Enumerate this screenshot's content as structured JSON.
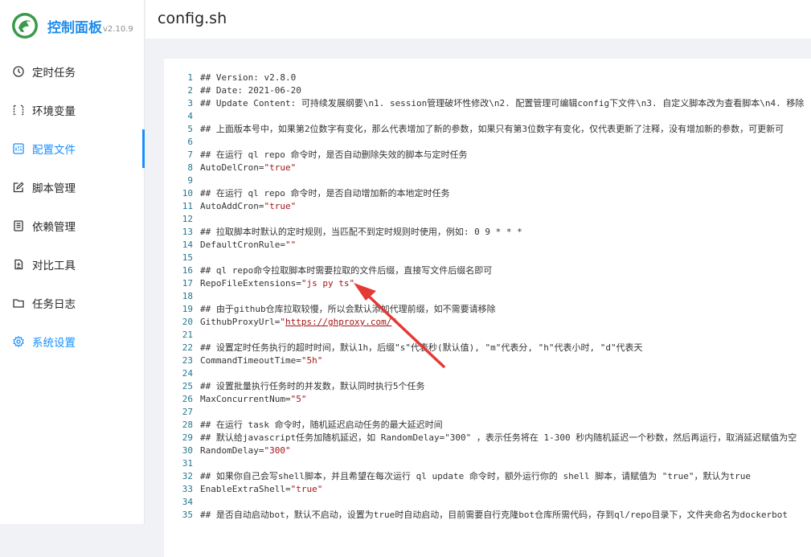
{
  "app": {
    "name": "控制面板",
    "version": "v2.10.9"
  },
  "sidebar": {
    "items": [
      {
        "label": "定时任务",
        "icon": "clock-icon"
      },
      {
        "label": "环境变量",
        "icon": "variable-icon"
      },
      {
        "label": "配置文件",
        "icon": "control-icon",
        "active": true
      },
      {
        "label": "脚本管理",
        "icon": "edit-icon"
      },
      {
        "label": "依赖管理",
        "icon": "container-icon"
      },
      {
        "label": "对比工具",
        "icon": "diff-icon"
      },
      {
        "label": "任务日志",
        "icon": "folder-icon"
      },
      {
        "label": "系统设置",
        "icon": "gear-icon"
      }
    ]
  },
  "header": {
    "title": "config.sh"
  },
  "colors": {
    "accent": "#1890ff",
    "brand": "#1f8ded",
    "string": "#a31515",
    "line_number": "#237893",
    "arrow": "#e53935"
  },
  "editor": {
    "lines": [
      {
        "n": "1",
        "text": "## Version: v2.8.0"
      },
      {
        "n": "2",
        "text": "## Date: 2021-06-20"
      },
      {
        "n": "3",
        "text": "## Update Content: 可持续发展纲要\\n1. session管理破坏性修改\\n2. 配置管理可编辑config下文件\\n3. 自定义脚本改为查看脚本\\n4. 移除"
      },
      {
        "n": "4",
        "text": ""
      },
      {
        "n": "5",
        "text": "## 上面版本号中，如果第2位数字有变化，那么代表增加了新的参数，如果只有第3位数字有变化，仅代表更新了注释，没有增加新的参数，可更新可"
      },
      {
        "n": "6",
        "text": ""
      },
      {
        "n": "7",
        "text": "## 在运行 ql repo 命令时，是否自动删除失效的脚本与定时任务"
      },
      {
        "n": "8",
        "key": "AutoDelCron=",
        "str": "\"true\""
      },
      {
        "n": "9",
        "text": ""
      },
      {
        "n": "10",
        "text": "## 在运行 ql repo 命令时，是否自动增加新的本地定时任务"
      },
      {
        "n": "11",
        "key": "AutoAddCron=",
        "str": "\"true\""
      },
      {
        "n": "12",
        "text": ""
      },
      {
        "n": "13",
        "text": "## 拉取脚本时默认的定时规则，当匹配不到定时规则时使用，例如: 0 9 * * *"
      },
      {
        "n": "14",
        "key": "DefaultCronRule=",
        "str": "\"\""
      },
      {
        "n": "15",
        "text": ""
      },
      {
        "n": "16",
        "text": "## ql repo命令拉取脚本时需要拉取的文件后缀，直接写文件后缀名即可"
      },
      {
        "n": "17",
        "key": "RepoFileExtensions=",
        "str": "\"js py ts\""
      },
      {
        "n": "18",
        "text": ""
      },
      {
        "n": "19",
        "text": "## 由于github仓库拉取较慢，所以会默认添加代理前缀，如不需要请移除"
      },
      {
        "n": "20",
        "key": "GithubProxyUrl=",
        "str": "\"",
        "link": "https://ghproxy.com/",
        "str_end": "\""
      },
      {
        "n": "21",
        "text": ""
      },
      {
        "n": "22",
        "text": "## 设置定时任务执行的超时时间，默认1h，后缀\"s\"代表秒(默认值), \"m\"代表分, \"h\"代表小时, \"d\"代表天"
      },
      {
        "n": "23",
        "key": "CommandTimeoutTime=",
        "str": "\"5h\""
      },
      {
        "n": "24",
        "text": ""
      },
      {
        "n": "25",
        "text": "## 设置批量执行任务时的并发数，默认同时执行5个任务"
      },
      {
        "n": "26",
        "key": "MaxConcurrentNum=",
        "str": "\"5\""
      },
      {
        "n": "27",
        "text": ""
      },
      {
        "n": "28",
        "text": "## 在运行 task 命令时，随机延迟启动任务的最大延迟时间"
      },
      {
        "n": "29",
        "text": "## 默认给javascript任务加随机延迟，如 RandomDelay=\"300\" ，表示任务将在 1-300 秒内随机延迟一个秒数，然后再运行，取消延迟赋值为空"
      },
      {
        "n": "30",
        "key": "RandomDelay=",
        "str": "\"300\""
      },
      {
        "n": "31",
        "text": ""
      },
      {
        "n": "32",
        "text": "## 如果你自己会写shell脚本，并且希望在每次运行 ql update 命令时，额外运行你的 shell 脚本，请赋值为 \"true\"，默认为true"
      },
      {
        "n": "33",
        "key": "EnableExtraShell=",
        "str": "\"true\""
      },
      {
        "n": "34",
        "text": ""
      },
      {
        "n": "35",
        "text": "## 是否自动启动bot，默认不启动，设置为true时自动启动，目前需要自行克隆bot仓库所需代码，存到ql/repo目录下，文件夹命名为dockerbot"
      }
    ]
  }
}
